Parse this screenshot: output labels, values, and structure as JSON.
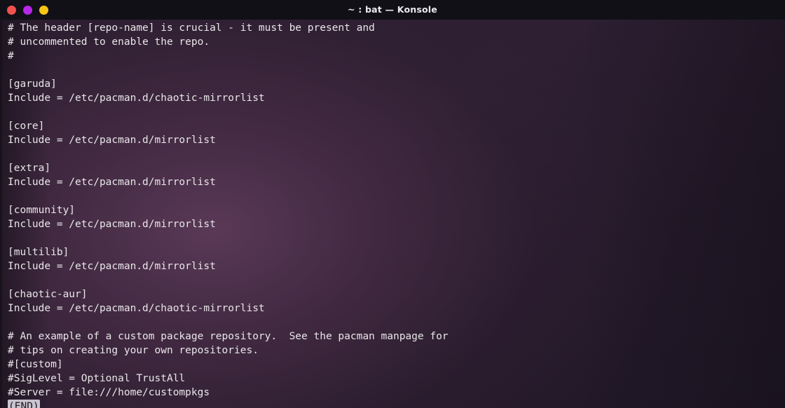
{
  "titlebar": {
    "title": "~ : bat — Konsole",
    "buttons": [
      {
        "name": "close",
        "color": "#f0514e"
      },
      {
        "name": "minimize",
        "color": "#b628e8"
      },
      {
        "name": "maximize",
        "color": "#f5c518"
      }
    ]
  },
  "terminal": {
    "program": "bat",
    "pager_status": "(END)",
    "colors": {
      "background": "#2a1b2e",
      "glow": "#452c44",
      "foreground": "#e8e6e8",
      "titlebar_background": "#111016",
      "status_background": "#c8c4d0",
      "status_foreground": "#20161f"
    },
    "lines": [
      "# The header [repo-name] is crucial - it must be present and",
      "# uncommented to enable the repo.",
      "#",
      "",
      "[garuda]",
      "Include = /etc/pacman.d/chaotic-mirrorlist",
      "",
      "[core]",
      "Include = /etc/pacman.d/mirrorlist",
      "",
      "[extra]",
      "Include = /etc/pacman.d/mirrorlist",
      "",
      "[community]",
      "Include = /etc/pacman.d/mirrorlist",
      "",
      "[multilib]",
      "Include = /etc/pacman.d/mirrorlist",
      "",
      "[chaotic-aur]",
      "Include = /etc/pacman.d/chaotic-mirrorlist",
      "",
      "# An example of a custom package repository.  See the pacman manpage for",
      "# tips on creating your own repositories.",
      "#[custom]",
      "#SigLevel = Optional TrustAll",
      "#Server = file:///home/custompkgs"
    ]
  }
}
